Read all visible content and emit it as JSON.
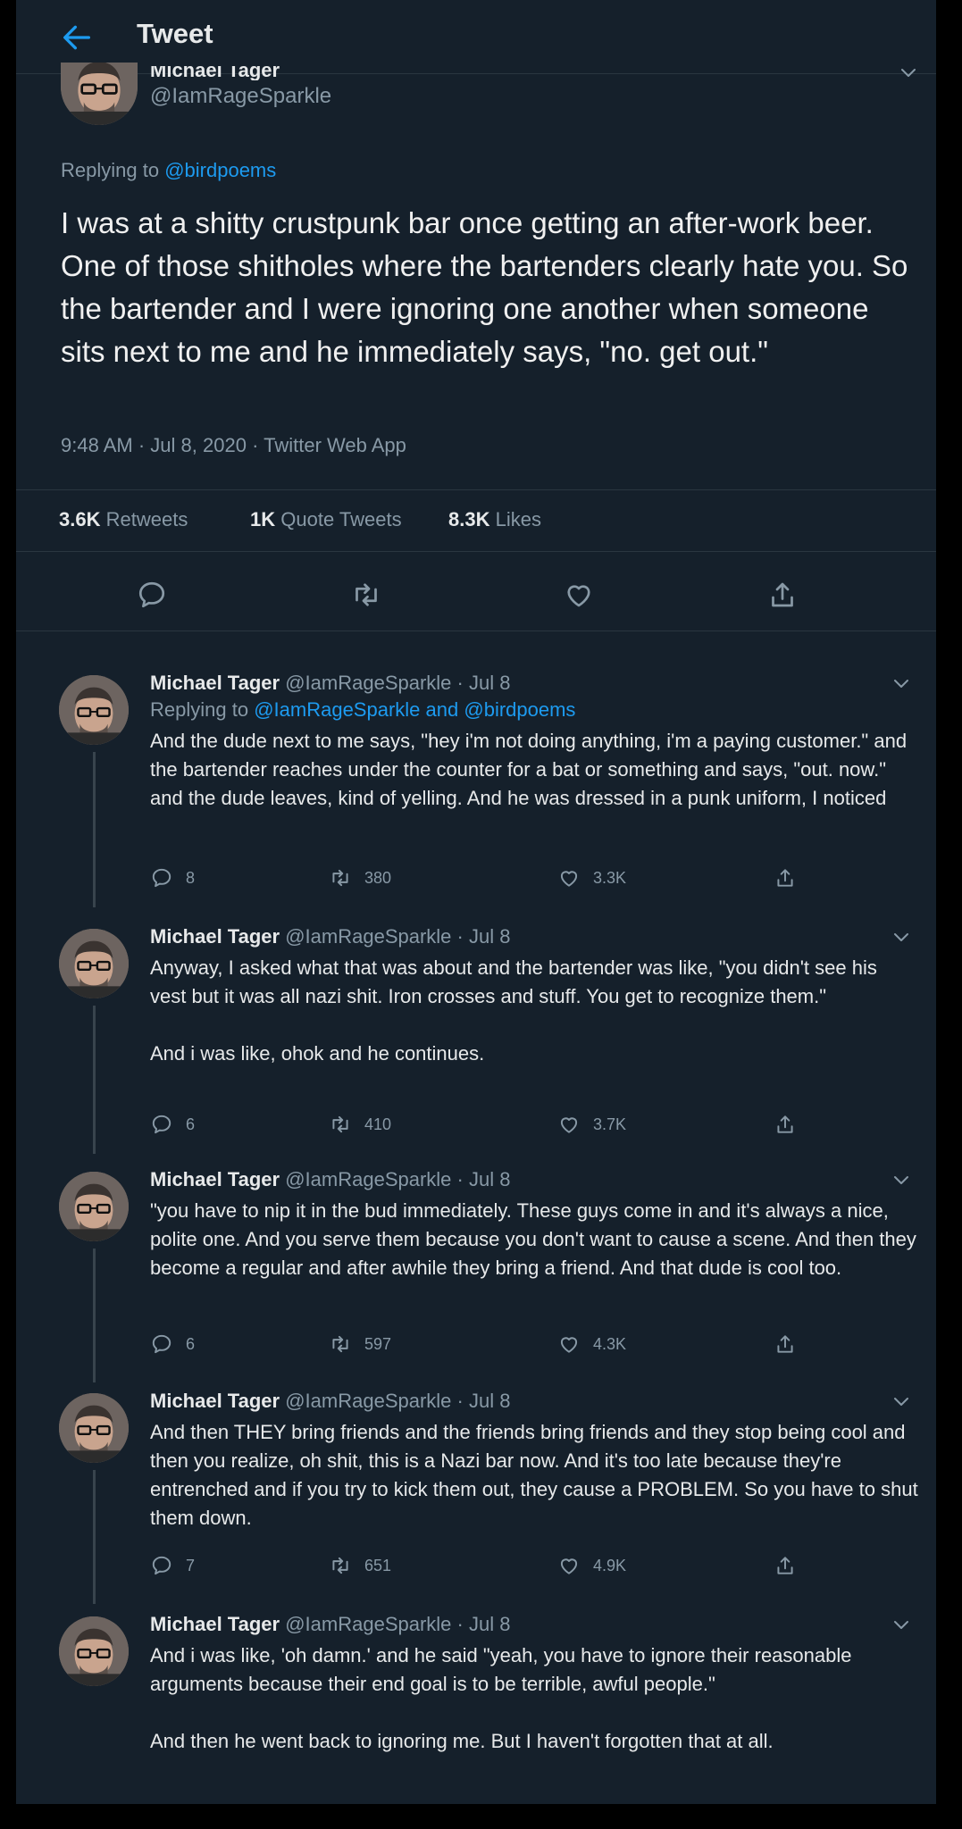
{
  "header": {
    "title": "Tweet"
  },
  "main_tweet": {
    "name": "Michael Tager",
    "handle": "@IamRageSparkle",
    "replying_prefix": "Replying to",
    "replying_to": "@birdpoems",
    "text": "I was at a shitty crustpunk bar once getting an after-work beer. One of those shitholes where the bartenders clearly hate you. So the bartender and I were ignoring one another when someone sits next to me and he immediately says, \"no. get out.\"",
    "time": "9:48 AM",
    "date": "Jul 8, 2020",
    "source": "Twitter Web App",
    "sep": "·",
    "retweets_count": "3.6K",
    "retweets_label": "Retweets",
    "quotes_count": "1K",
    "quotes_label": "Quote Tweets",
    "likes_count": "8.3K",
    "likes_label": "Likes"
  },
  "replies": [
    {
      "name": "Michael Tager",
      "handle": "@IamRageSparkle",
      "sep": "·",
      "date": "Jul 8",
      "replying_prefix": "Replying to",
      "replying_a": "@IamRageSparkle",
      "replying_and": "and",
      "replying_b": "@birdpoems",
      "text": "And the dude next to me says, \"hey i'm not doing anything, i'm a paying customer.\" and the bartender reaches under the counter for a bat or something and says, \"out. now.\" and the dude leaves, kind of yelling. And he was dressed in a punk uniform, I noticed",
      "replies": "8",
      "retweets": "380",
      "likes": "3.3K"
    },
    {
      "name": "Michael Tager",
      "handle": "@IamRageSparkle",
      "sep": "·",
      "date": "Jul 8",
      "text": "Anyway, I asked what that was about and the bartender was like, \"you didn't see his vest but it was all nazi shit. Iron crosses and stuff. You get to recognize them.\"\n\nAnd i was like, ohok and he continues.",
      "replies": "6",
      "retweets": "410",
      "likes": "3.7K"
    },
    {
      "name": "Michael Tager",
      "handle": "@IamRageSparkle",
      "sep": "·",
      "date": "Jul 8",
      "text": "\"you have to nip it in the bud immediately. These guys come in and it's always a nice, polite one. And you serve them because you don't want to cause a scene. And then they become a regular and after awhile they bring a friend. And that dude is cool too.",
      "replies": "6",
      "retweets": "597",
      "likes": "4.3K"
    },
    {
      "name": "Michael Tager",
      "handle": "@IamRageSparkle",
      "sep": "·",
      "date": "Jul 8",
      "text": "And then THEY bring friends and the friends bring friends and they stop being cool and then you realize, oh shit, this is a Nazi bar now. And it's too late because they're entrenched and if you try to kick them out, they cause a PROBLEM. So you have to shut them down.",
      "replies": "7",
      "retweets": "651",
      "likes": "4.9K"
    },
    {
      "name": "Michael Tager",
      "handle": "@IamRageSparkle",
      "sep": "·",
      "date": "Jul 8",
      "text": "And i was like, 'oh damn.' and he said \"yeah, you have to ignore their reasonable arguments because their end goal is to be terrible, awful people.\"\n\nAnd then he went back to ignoring me. But I haven't forgotten that at all."
    }
  ],
  "colors": {
    "background": "#15202b",
    "accent": "#1d9bf0",
    "muted": "#8899a6",
    "text": "#e7e9ea"
  },
  "icons": [
    "back-arrow-icon",
    "reply-icon",
    "retweet-icon",
    "like-icon",
    "share-icon",
    "chevron-down-icon"
  ]
}
